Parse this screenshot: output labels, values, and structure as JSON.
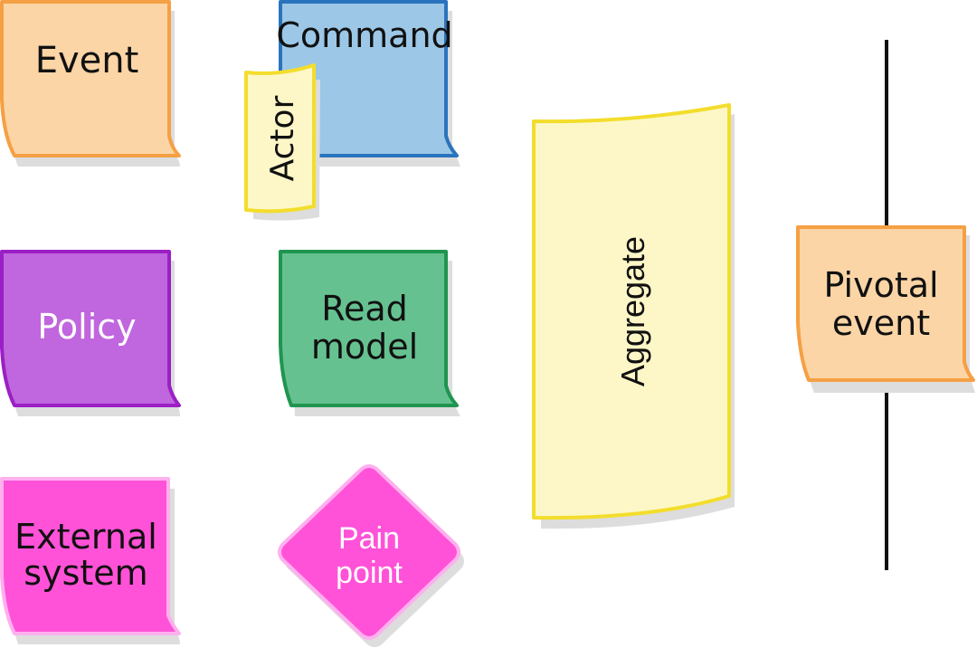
{
  "stickies": {
    "event": {
      "label": "Event",
      "fill": "#fbd5a6",
      "stroke": "#f5a044"
    },
    "command": {
      "label": "Command",
      "fill": "#9cc7e6",
      "stroke": "#2a74bd"
    },
    "actor": {
      "label": "Actor",
      "fill": "#fdf7c7",
      "stroke": "#f3dd2c"
    },
    "policy": {
      "label": "Policy",
      "fill": "#c066de",
      "stroke": "#9b1fc5",
      "text_color": "#ffffff"
    },
    "read_model": {
      "label_line1": "Read",
      "label_line2": "model",
      "fill": "#66c190",
      "stroke": "#1f9550"
    },
    "aggregate": {
      "label": "Aggregate",
      "fill": "#fdf7c7",
      "stroke": "#f3dd2c"
    },
    "pivotal_event": {
      "label_line1": "Pivotal",
      "label_line2": "event",
      "fill": "#fbd5a6",
      "stroke": "#f5a044"
    },
    "external_system": {
      "label_line1": "External",
      "label_line2": "system",
      "fill": "#ff52d8",
      "stroke": "#ffb0ee"
    },
    "pain_point": {
      "label_line1": "Pain",
      "label_line2": "point",
      "fill": "#ff52d8",
      "stroke": "#ffb0ee",
      "text_color": "#ffffff"
    }
  },
  "colors": {
    "shadow": "#dddddd",
    "divider": "#111111"
  }
}
